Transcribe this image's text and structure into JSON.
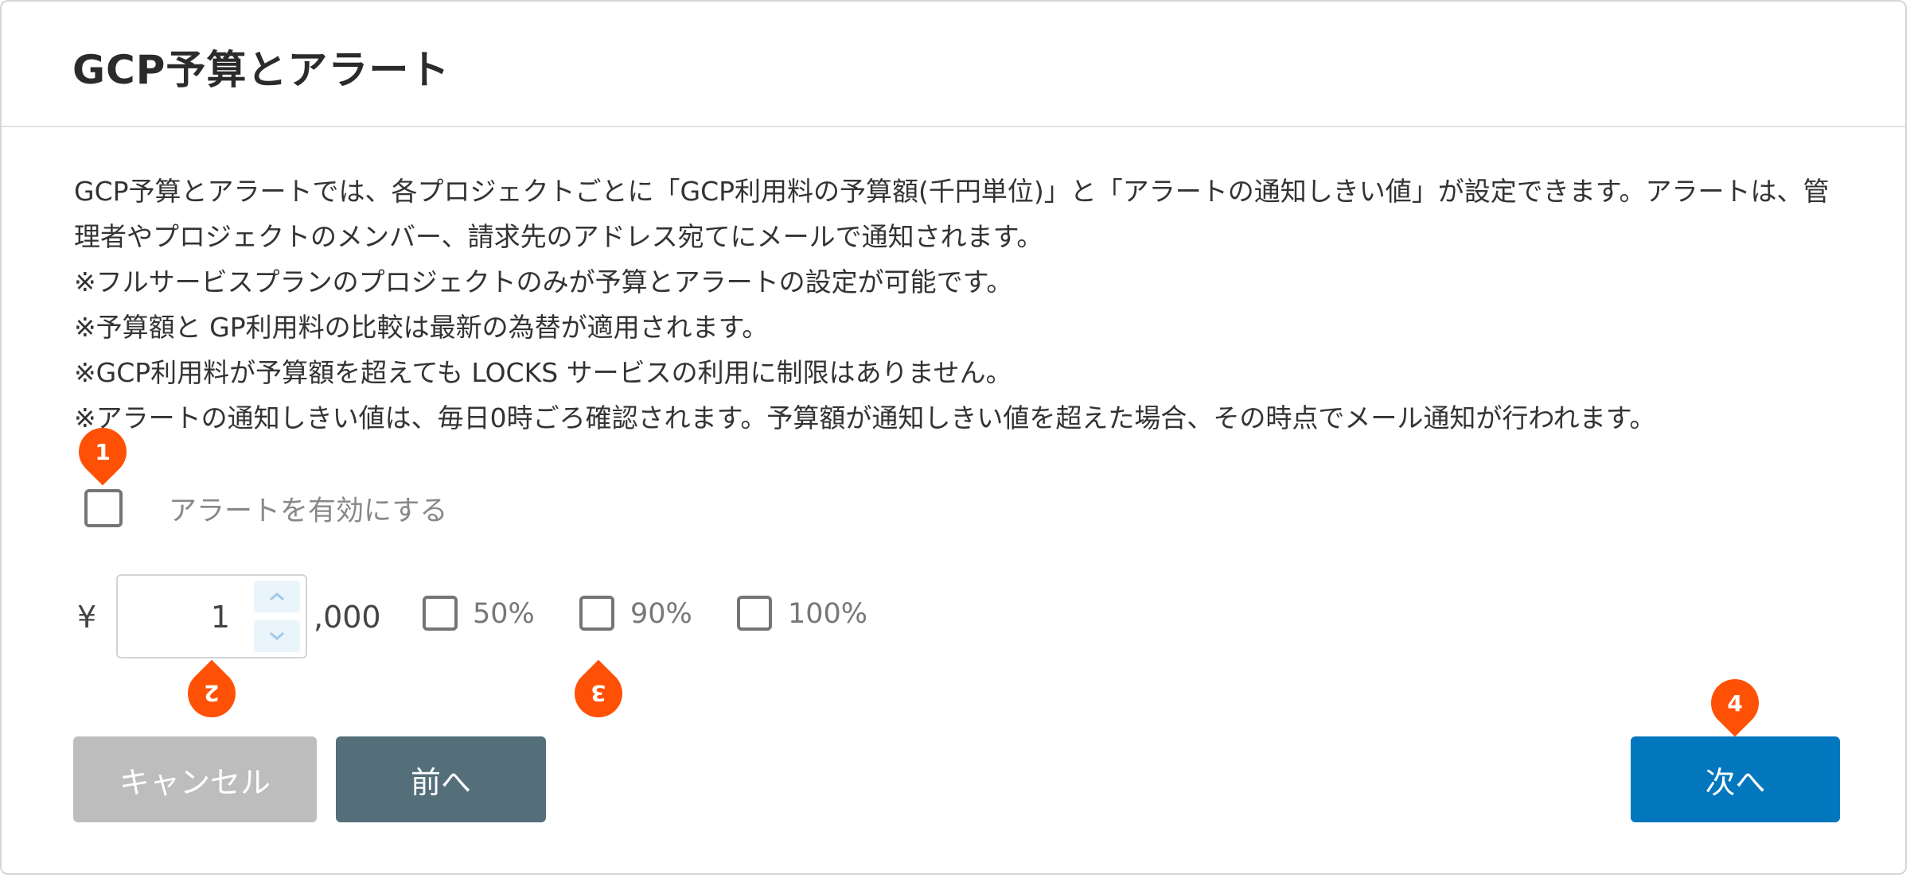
{
  "dialog": {
    "title": "GCP予算とアラート"
  },
  "description": {
    "lines": [
      "GCP予算とアラートでは、各プロジェクトごとに「GCP利用料の予算額(千円単位)」と「アラートの通知しきい値」が設定できます。アラートは、管理者やプロジェクトのメンバー、請求先のアドレス宛てにメールで通知されます。",
      "※フルサービスプランのプロジェクトのみが予算とアラートの設定が可能です。",
      "※予算額と GP利用料の比較は最新の為替が適用されます。",
      "※GCP利用料が予算額を超えても LOCKS サービスの利用に制限はありません。",
      "※アラートの通知しきい値は、毎日0時ごろ確認されます。予算額が通知しきい値を超えた場合、その時点でメール通知が行われます。"
    ]
  },
  "alert_toggle": {
    "label": "アラートを有効にする",
    "checked": false
  },
  "budget": {
    "currency_symbol": "¥",
    "value": "1",
    "suffix": ",000"
  },
  "thresholds": [
    {
      "label": "50%",
      "checked": false
    },
    {
      "label": "90%",
      "checked": false
    },
    {
      "label": "100%",
      "checked": false
    }
  ],
  "buttons": {
    "cancel": "キャンセル",
    "prev": "前へ",
    "next": "次へ"
  },
  "callouts": [
    "1",
    "2",
    "3",
    "4"
  ],
  "colors": {
    "callout": "#ff5106",
    "cancel_button": "#bdbdbd",
    "prev_button": "#546e7a",
    "next_button": "#0277bd"
  },
  "icons": {
    "spin_up": "chevron-up-icon",
    "spin_down": "chevron-down-icon"
  }
}
